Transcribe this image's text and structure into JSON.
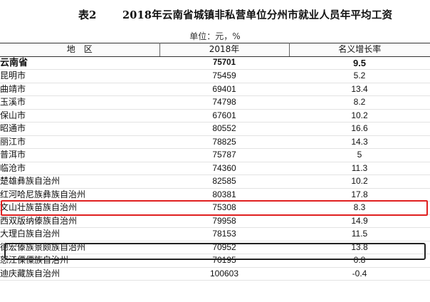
{
  "title": {
    "table_no": "表2",
    "text": "2018年云南省城镇非私营单位分州市就业人员年平均工资"
  },
  "unit": "单位：元，%",
  "headers": [
    "地　区",
    "2018年",
    "名义增长率"
  ],
  "rows": [
    {
      "region": "云南省",
      "value": "75701",
      "growth": "9.5"
    },
    {
      "region": "昆明市",
      "value": "75459",
      "growth": "5.2"
    },
    {
      "region": "曲靖市",
      "value": "69401",
      "growth": "13.4"
    },
    {
      "region": "玉溪市",
      "value": "74798",
      "growth": "8.2"
    },
    {
      "region": "保山市",
      "value": "67601",
      "growth": "10.2"
    },
    {
      "region": "昭通市",
      "value": "80552",
      "growth": "16.6"
    },
    {
      "region": "丽江市",
      "value": "78825",
      "growth": "14.3"
    },
    {
      "region": "普洱市",
      "value": "75787",
      "growth": "5"
    },
    {
      "region": "临沧市",
      "value": "74360",
      "growth": "11.3"
    },
    {
      "region": "楚雄彝族自治州",
      "value": "82585",
      "growth": "10.2"
    },
    {
      "region": "红河哈尼族彝族自治州",
      "value": "80381",
      "growth": "17.8"
    },
    {
      "region": "文山壮族苗族自治州",
      "value": "75308",
      "growth": "8.3"
    },
    {
      "region": "西双版纳傣族自治州",
      "value": "79958",
      "growth": "14.9"
    },
    {
      "region": "大理白族自治州",
      "value": "78153",
      "growth": "11.5"
    },
    {
      "region": "德宏傣族景颇族自治州",
      "value": "70952",
      "growth": "13.8"
    },
    {
      "region": "怒江傈僳族自治州",
      "value": "70195",
      "growth": "0.8"
    },
    {
      "region": "迪庆藏族自治州",
      "value": "100603",
      "growth": "-0.4"
    }
  ]
}
